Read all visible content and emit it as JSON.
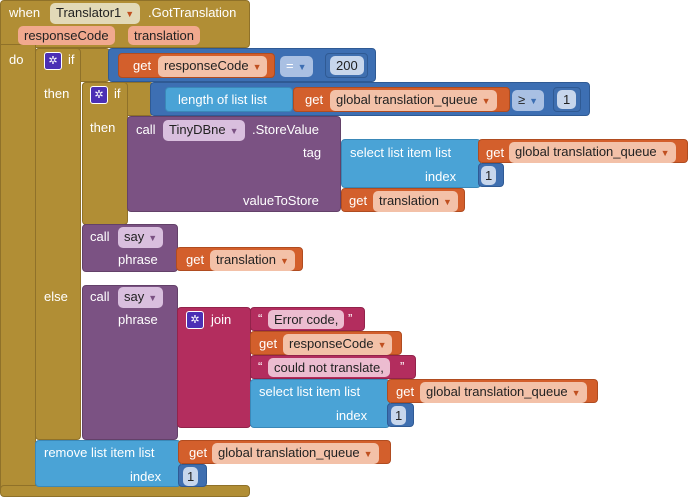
{
  "event": {
    "when": "when",
    "component": "Translator1",
    "event": ".GotTranslation",
    "params": [
      "responseCode",
      "translation"
    ],
    "do": "do"
  },
  "if1": {
    "if": "if",
    "then": "then",
    "else": "else",
    "get": "get",
    "var": "responseCode",
    "op": "=",
    "num": "200"
  },
  "if2": {
    "if": "if",
    "then": "then",
    "length": "length of list  list",
    "get": "get",
    "var": "global translation_queue",
    "op": "≥",
    "num": "1"
  },
  "store": {
    "call": "call",
    "component": "TinyDBne",
    "method": ".StoreValue",
    "tag": "tag",
    "value": "valueToStore",
    "select": "select list item  list",
    "get": "get",
    "var": "global translation_queue",
    "index": "index",
    "num": "1",
    "get2": "get",
    "var2": "translation"
  },
  "say1": {
    "call": "call",
    "method": "say",
    "phrase": "phrase",
    "get": "get",
    "var": "translation"
  },
  "say2": {
    "call": "call",
    "method": "say",
    "phrase": "phrase",
    "join": "join",
    "str1": "Error code,",
    "get": "get",
    "var": "responseCode",
    "str2": " could not translate,",
    "select": "select list item  list",
    "get2": "get",
    "var2": "global translation_queue",
    "index": "index",
    "num": "1",
    "q_open": "“",
    "q_close": "”"
  },
  "remove": {
    "label": "remove list item  list",
    "get": "get",
    "var": "global translation_queue",
    "index": "index",
    "num": "1"
  }
}
